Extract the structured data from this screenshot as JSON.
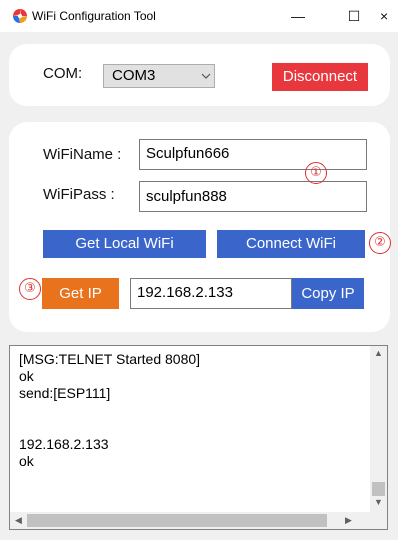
{
  "window": {
    "title": "WiFi Configuration Tool",
    "minimize_glyph": "—",
    "maximize_glyph": "☐",
    "close_glyph": "×"
  },
  "serial": {
    "com_label": "COM:",
    "com_selected": "COM3",
    "disconnect_label": "Disconnect",
    "disconnect_color": "#e8383d"
  },
  "wifi": {
    "name_label": "WiFiName :",
    "name_value": "Sculpfun666",
    "pass_label": "WiFiPass :",
    "pass_value": "sculpfun888",
    "get_local_label": "Get Local WiFi",
    "connect_label": "Connect WiFi",
    "get_ip_label": "Get IP",
    "ip_value": "192.168.2.133",
    "copy_ip_label": "Copy IP",
    "blue_color": "#3a66cc",
    "orange_color": "#e8731c"
  },
  "annotations": {
    "one": "①",
    "two": "②",
    "three": "③"
  },
  "log": {
    "lines": [
      "[MSG:TELNET Started 8080]",
      "ok",
      "send:[ESP111]",
      "",
      "",
      "192.168.2.133",
      "ok"
    ]
  }
}
